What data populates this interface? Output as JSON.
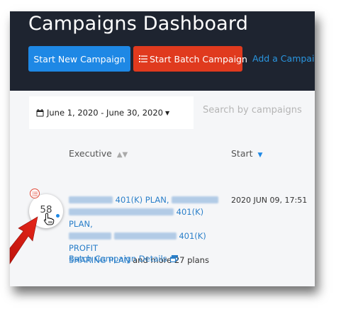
{
  "header": {
    "title": "Campaigns Dashboard",
    "start_new_label": "Start New Campaign",
    "start_batch_label": "Start Batch Campaign",
    "add_campaign_label": "Add a Campaign"
  },
  "filters": {
    "date_range": "June 1, 2020 - June 30, 2020",
    "search_placeholder": "Search by campaigns"
  },
  "table": {
    "columns": [
      {
        "label": "Executive",
        "sort": "unsorted"
      },
      {
        "label": "Start",
        "sort": "descending"
      }
    ],
    "rows": [
      {
        "count": "58",
        "plans": [
          "401(K) PLAN,",
          "401(K) PLAN,",
          "401(K) PROFIT",
          "SHARING PLAN"
        ],
        "more_text": " and more 27 plans",
        "start": "2020 JUN 09, 17:51",
        "details_label": "Batch Campaign Details"
      }
    ]
  },
  "colors": {
    "header_bg": "#1e2430",
    "primary": "#1e88e5",
    "danger": "#e03a1e",
    "link": "#2a7fc9"
  },
  "icons": [
    "calendar-icon",
    "list-icon",
    "sort-icon",
    "external-window-icon",
    "hand-cursor-icon",
    "red-arrow-annotation"
  ]
}
